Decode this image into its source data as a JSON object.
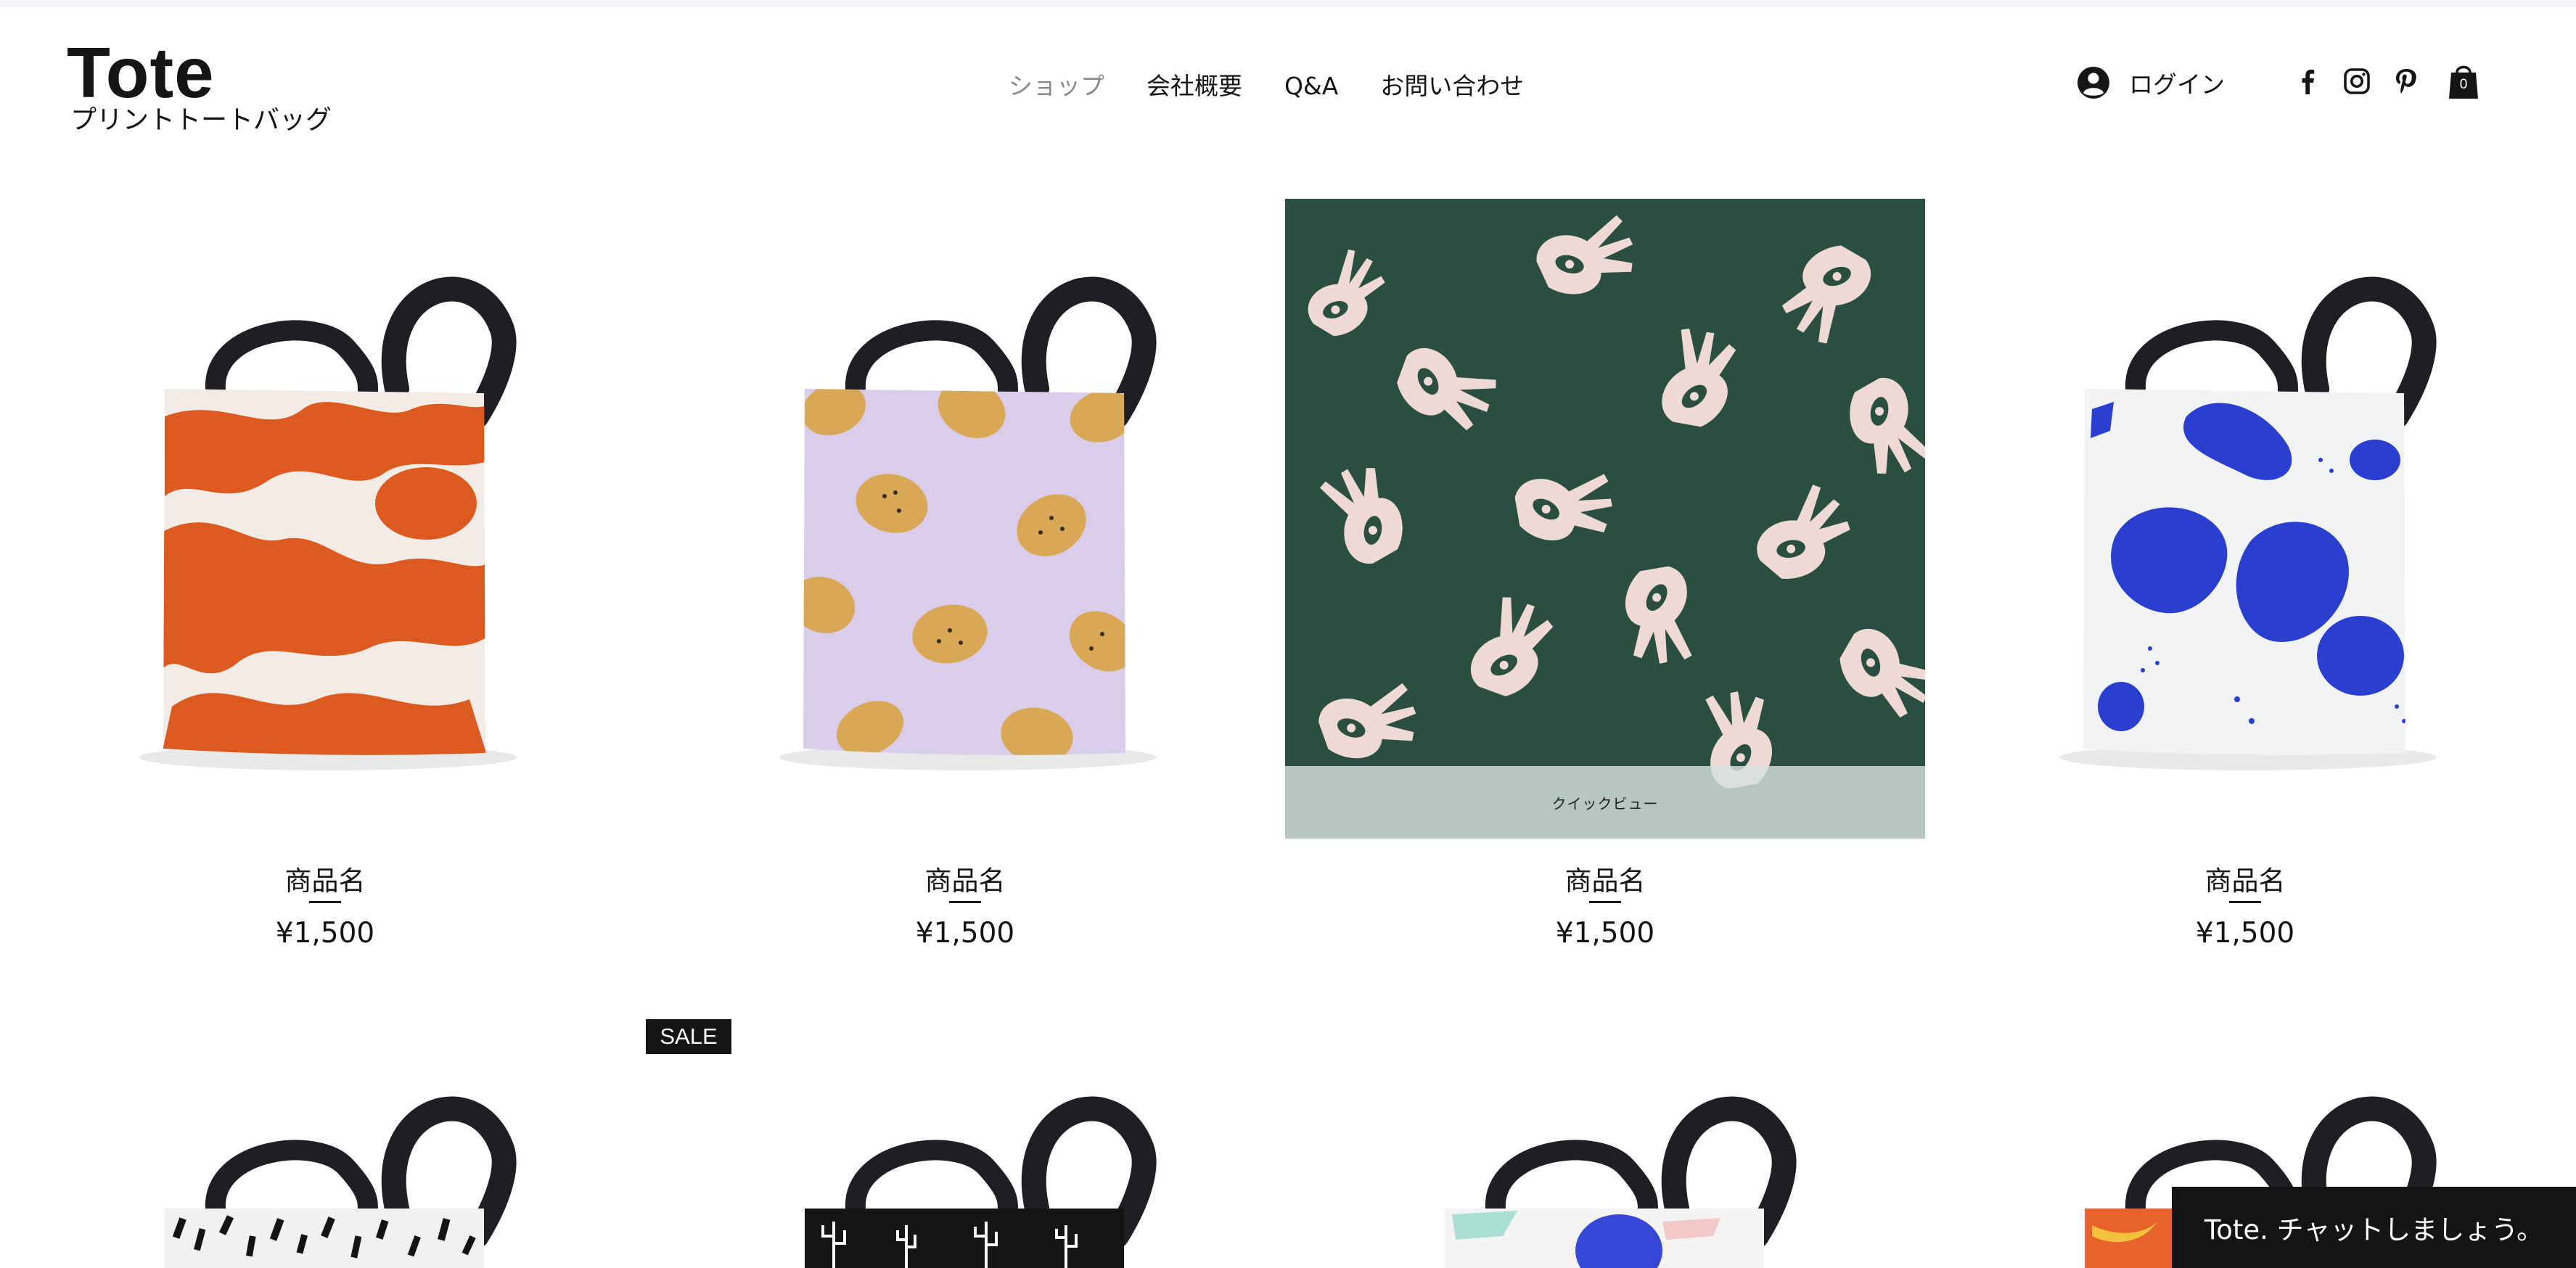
{
  "header": {
    "logo_title": "Tote",
    "logo_subtitle": "プリントトートバッグ",
    "nav": [
      {
        "label": "ショップ",
        "active": true
      },
      {
        "label": "会社概要",
        "active": false
      },
      {
        "label": "Q&A",
        "active": false
      },
      {
        "label": "お問い合わせ",
        "active": false
      }
    ],
    "login_label": "ログイン",
    "login_icon": "user-avatar-icon",
    "social_icons": [
      "facebook-icon",
      "instagram-icon",
      "pinterest-icon"
    ],
    "cart_icon": "shopping-bag-icon",
    "cart_count": "0"
  },
  "products_row1": [
    {
      "name": "商品名",
      "price": "¥1,500",
      "pattern": "orange-brush-strokes"
    },
    {
      "name": "商品名",
      "price": "¥1,500",
      "pattern": "lemons-on-lilac"
    },
    {
      "name": "商品名",
      "price": "¥1,500",
      "pattern": "pink-hands-on-green",
      "quick_view_label": "クイックビュー"
    },
    {
      "name": "商品名",
      "price": "¥1,500",
      "pattern": "blue-blobs"
    }
  ],
  "products_row2": [
    {
      "pattern": "black-dabs"
    },
    {
      "pattern": "cactus-on-black",
      "badge": "SALE"
    },
    {
      "pattern": "pastel-abstract"
    },
    {
      "pattern": "bananas-on-orange"
    }
  ],
  "chat": {
    "label": "Tote. チャットしましょう。"
  },
  "colors": {
    "orange": "#dc5a1f",
    "lilac": "#d9cdea",
    "lemon": "#d9a857",
    "green": "#2a4f41",
    "pink": "#efd9d5",
    "blue": "#2a3fd0",
    "strap": "#1e1e24"
  }
}
